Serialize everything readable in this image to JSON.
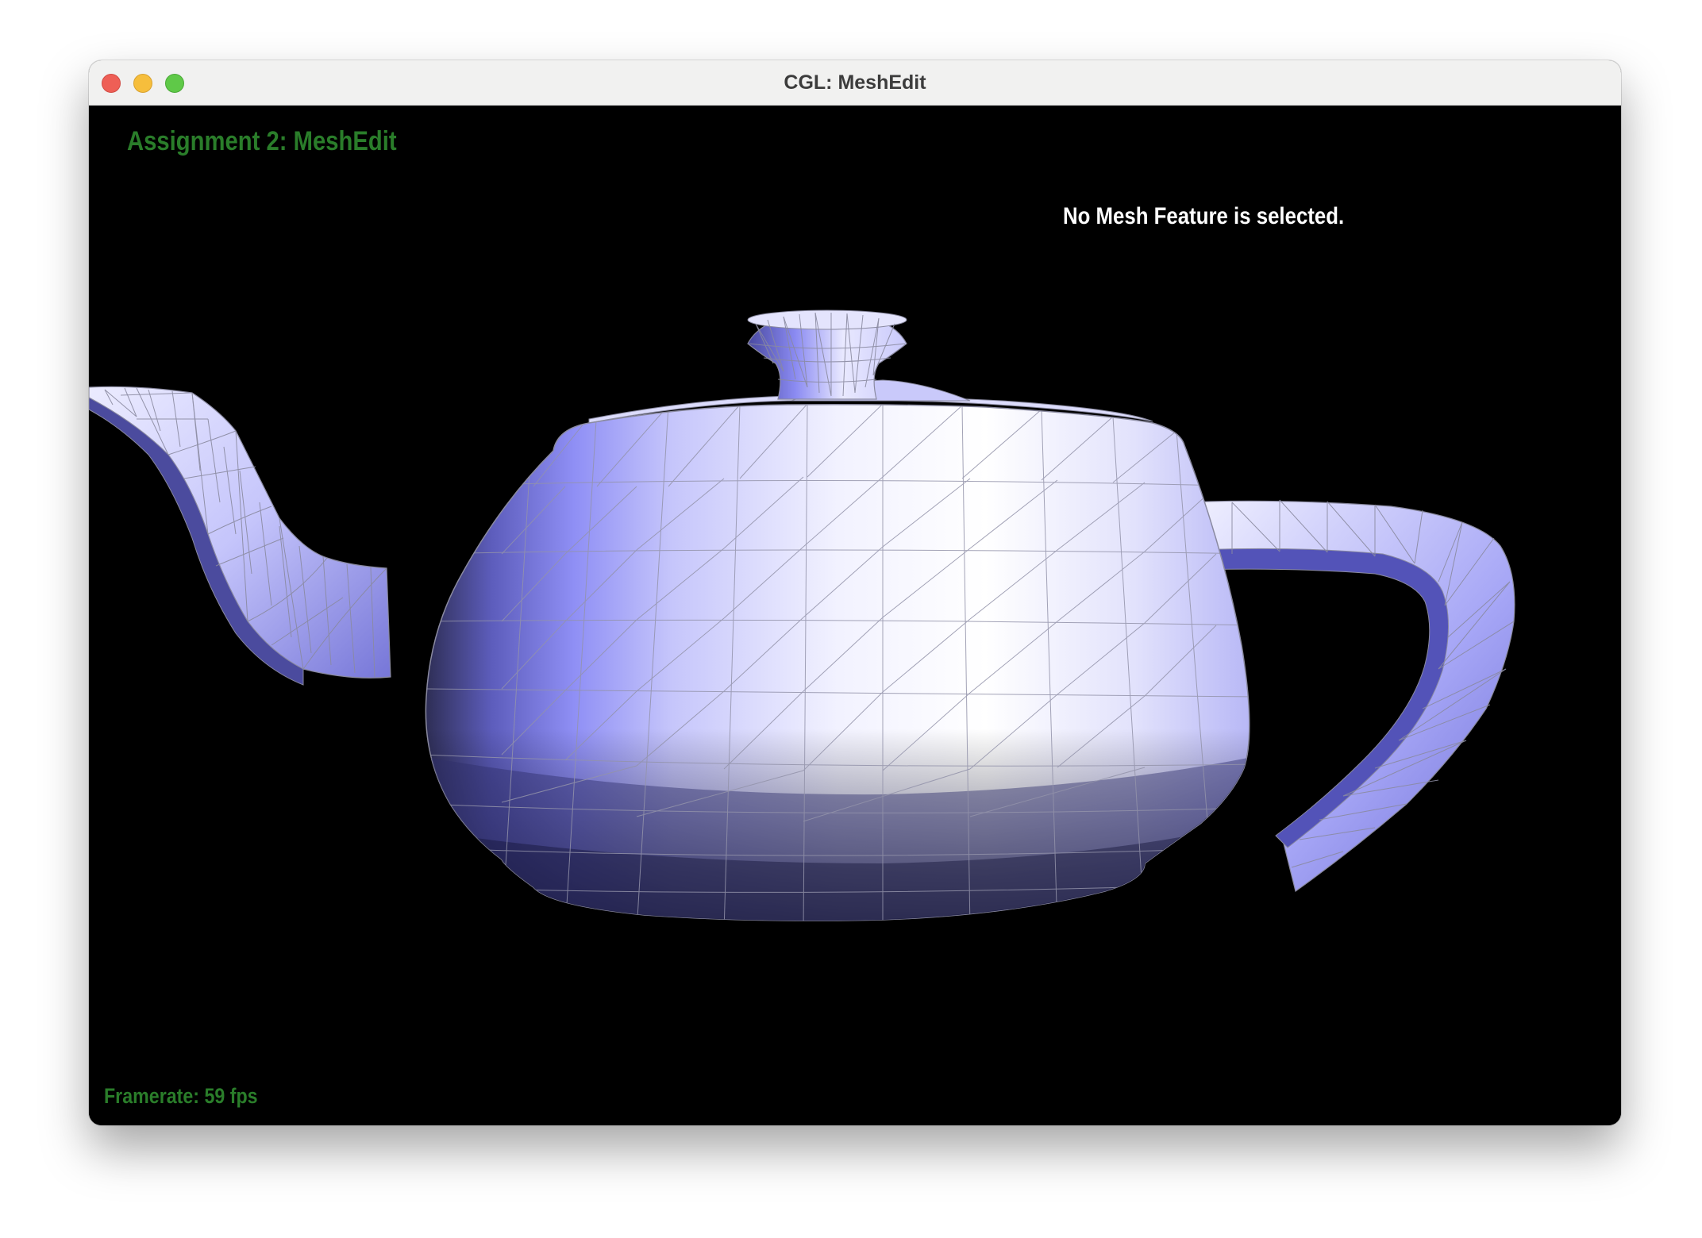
{
  "window": {
    "title": "CGL: MeshEdit"
  },
  "hud": {
    "title": "Assignment 2: MeshEdit",
    "selection_status": "No Mesh Feature is selected.",
    "framerate_label": "Framerate: 59 fps"
  },
  "scene": {
    "model": "teapot",
    "background_color": "#000000",
    "mesh_color": "#8f8ff5",
    "mesh_highlight_color": "#ffffff",
    "mesh_shadow_color": "#2e2e55",
    "wireframe_color": "#8a8aa0",
    "hud_green": "#2a7d2a"
  }
}
